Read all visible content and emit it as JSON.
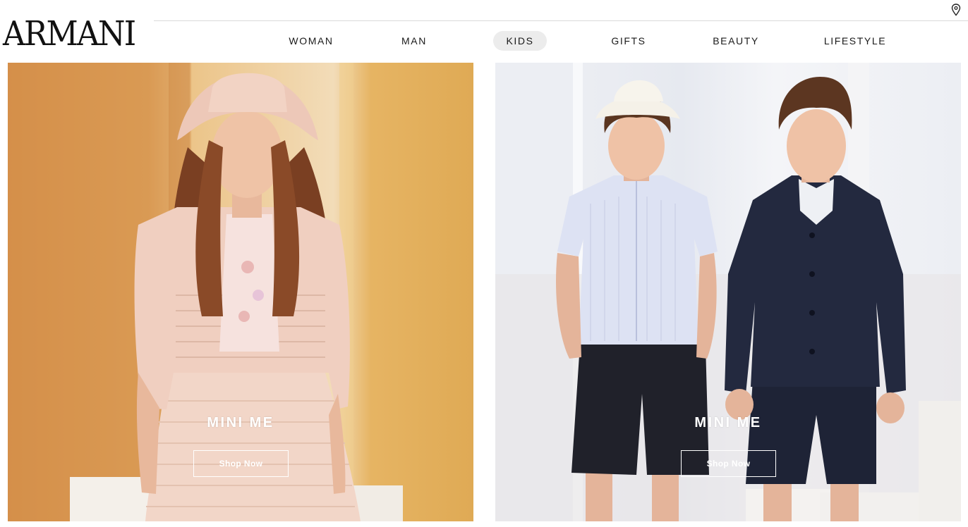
{
  "brand": {
    "logo_text": "ARMANI"
  },
  "header": {
    "location_icon": "location-pin-icon"
  },
  "nav": {
    "items": [
      {
        "label": "WOMAN"
      },
      {
        "label": "MAN"
      },
      {
        "label": "KIDS",
        "active": true
      },
      {
        "label": "GIFTS"
      },
      {
        "label": "BEAUTY"
      },
      {
        "label": "LIFESTYLE"
      }
    ]
  },
  "promos": [
    {
      "title": "MINI ME",
      "button_label": "Shop Now"
    },
    {
      "title": "MINI ME",
      "button_label": "Shop Now"
    }
  ],
  "colors": {
    "nav_active_bg": "#ececec",
    "overlay_text": "#ffffff"
  }
}
